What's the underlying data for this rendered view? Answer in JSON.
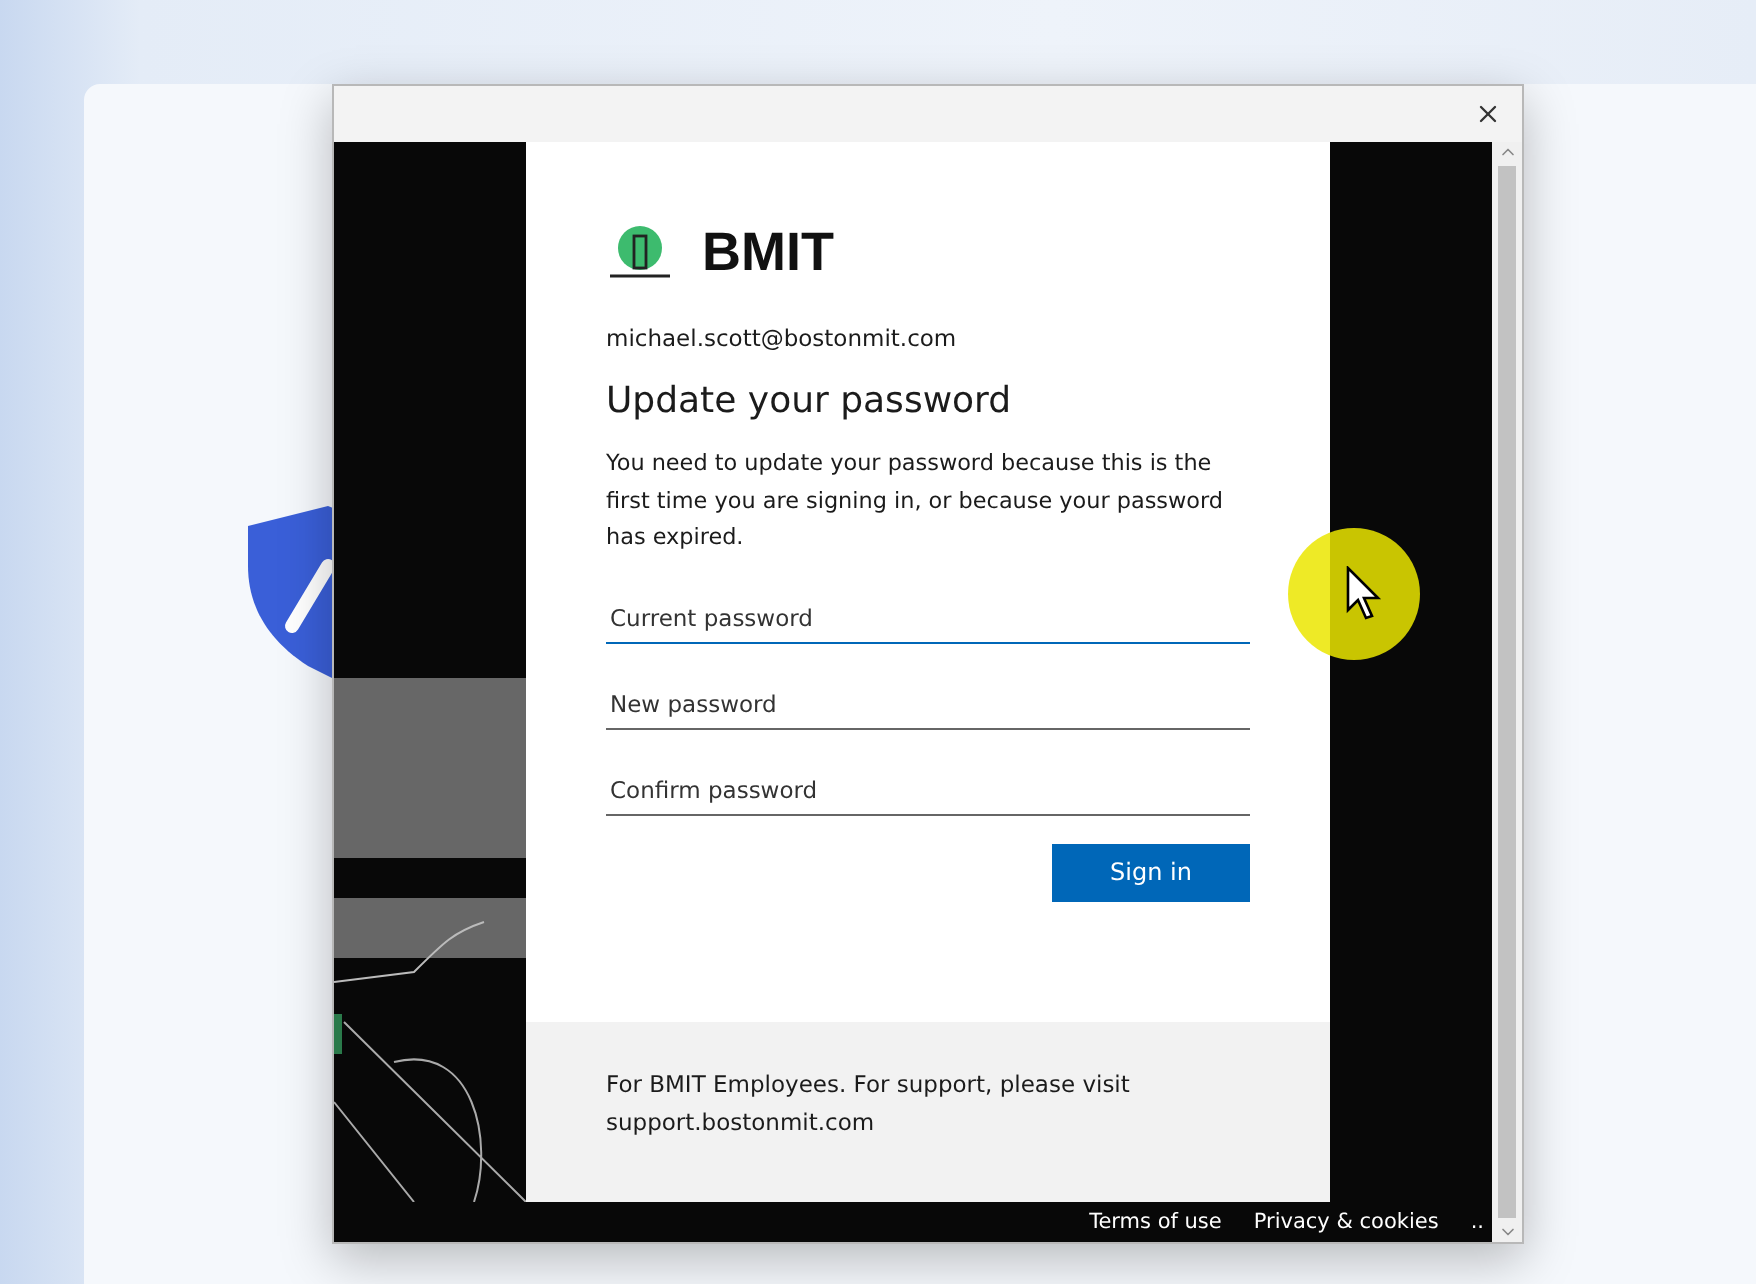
{
  "brand": {
    "name": "BMIT"
  },
  "account": "michael.scott@bostonmit.com",
  "heading": "Update your password",
  "message": "You need to update your password because this is the first time you are signing in, or because your password has expired.",
  "fields": [
    {
      "placeholder": "Current password",
      "focused": true
    },
    {
      "placeholder": "New password",
      "focused": false
    },
    {
      "placeholder": "Confirm password",
      "focused": false
    }
  ],
  "submit": "Sign in",
  "support_text": "For BMIT Employees. For support, please visit support.bostonmit.com",
  "footer_links": [
    "Terms of use",
    "Privacy & cookies"
  ],
  "footer_more": "..",
  "recording_highlight": true
}
